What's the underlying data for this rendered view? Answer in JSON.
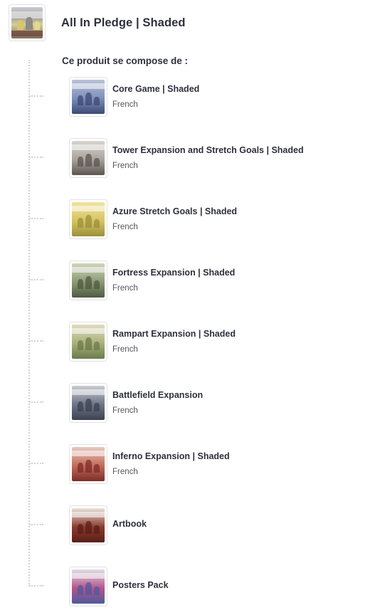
{
  "header": {
    "title": "All In Pledge | Shaded",
    "image_icon": "pledge-box-image"
  },
  "contents_label": "Ce produit se compose de :",
  "items": [
    {
      "name": "Core Game | Shaded",
      "lang": "French",
      "colors": [
        "#b9c3d8",
        "#7b8fb8",
        "#3d4a75"
      ]
    },
    {
      "name": "Tower Expansion and Stretch Goals | Shaded",
      "lang": "French",
      "colors": [
        "#d8d4ce",
        "#a9a39a",
        "#5b5550"
      ]
    },
    {
      "name": "Azure Stretch Goals | Shaded",
      "lang": "French",
      "colors": [
        "#efe4a0",
        "#d5c460",
        "#9c8f3c"
      ]
    },
    {
      "name": "Fortress Expansion | Shaded",
      "lang": "French",
      "colors": [
        "#cdd5bb",
        "#8b9a73",
        "#4e5a40"
      ]
    },
    {
      "name": "Rampart Expansion | Shaded",
      "lang": "French",
      "colors": [
        "#e0dcc0",
        "#a8b07a",
        "#6c7a4c"
      ]
    },
    {
      "name": "Battlefield Expansion",
      "lang": "French",
      "colors": [
        "#c9ccd2",
        "#6d7486",
        "#3c4250"
      ]
    },
    {
      "name": "Inferno Expansion | Shaded",
      "lang": "French",
      "colors": [
        "#e8c9c0",
        "#c46a58",
        "#7a2e28"
      ]
    },
    {
      "name": "Artbook",
      "lang": "",
      "colors": [
        "#e9e2d8",
        "#8a3a2e",
        "#5a1f18"
      ]
    },
    {
      "name": "Posters Pack",
      "lang": "",
      "colors": [
        "#e0dde4",
        "#b5538a",
        "#4e5a9c"
      ]
    }
  ]
}
